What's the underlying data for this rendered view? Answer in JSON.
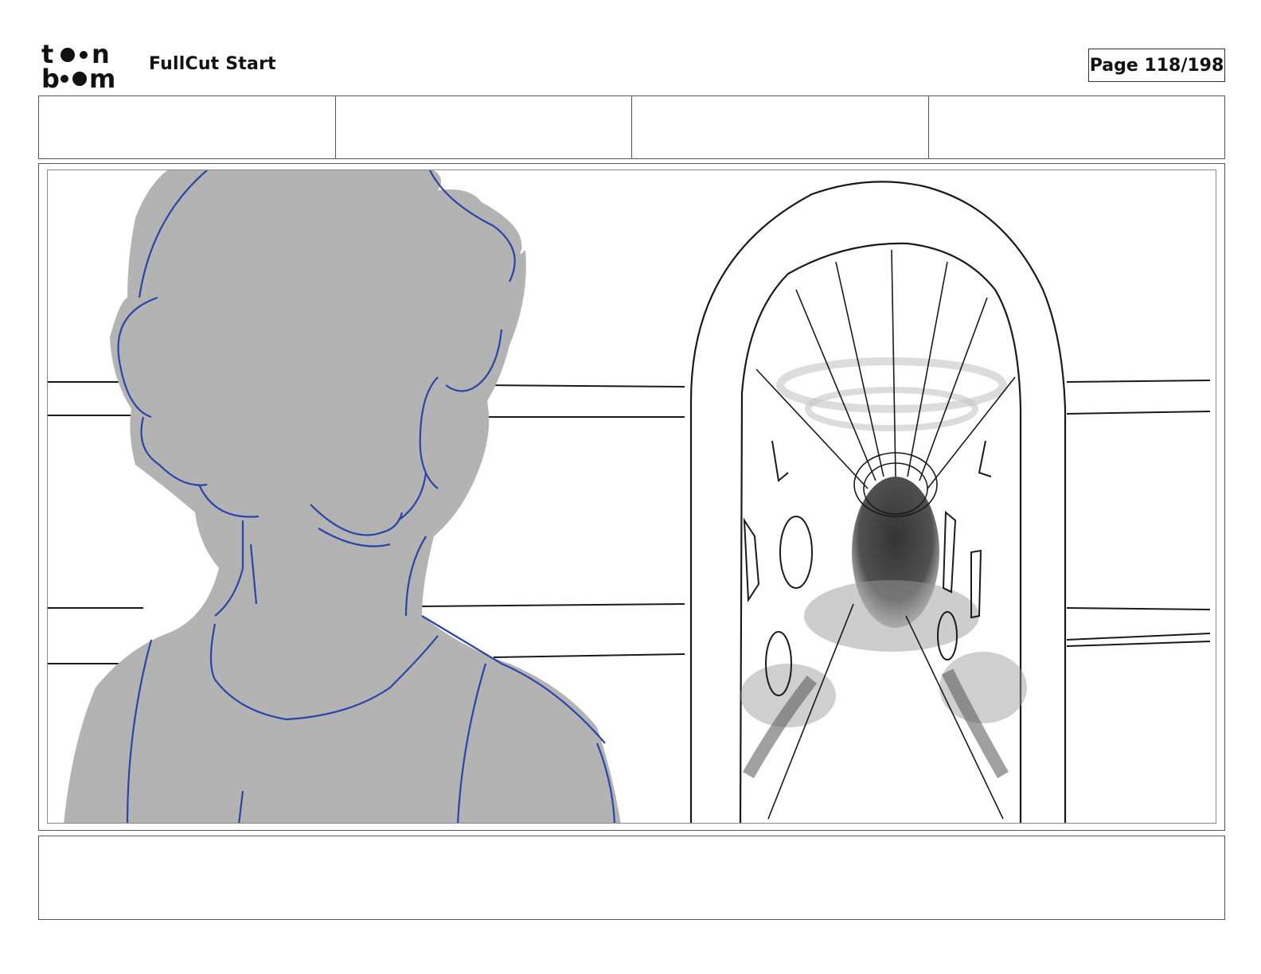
{
  "header": {
    "logo_line1": "toon",
    "logo_line2": "boom",
    "title": "FullCut Start",
    "page_label": "Page 118/198"
  },
  "info_cells": [
    "",
    "",
    "",
    ""
  ],
  "notes": {
    "text": ""
  },
  "colors": {
    "silhouette": "#b3b3b3",
    "line_blue": "#2b44a8",
    "ink": "#1a1a1a"
  }
}
